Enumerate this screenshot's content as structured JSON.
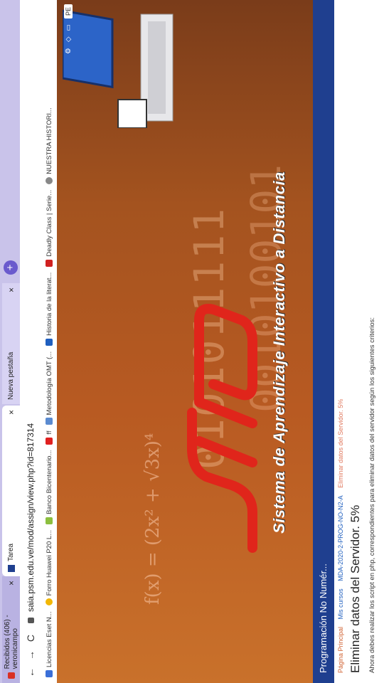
{
  "tabs": [
    {
      "label": "Recibidos (406) - veronicampo",
      "close": "×"
    },
    {
      "label": "Tarea",
      "close": "×"
    },
    {
      "label": "Nueva pestaña",
      "close": "×"
    }
  ],
  "new_tab": "+",
  "toolbar": {
    "back": "←",
    "forward": "→",
    "reload": "C",
    "url": "saia.psm.edu.ve/mod/assign/view.php?id=817314"
  },
  "bookmarks": [
    {
      "label": "Licencias Eset N...",
      "color": "#3a6fd8"
    },
    {
      "label": "Forro Huawei P20 L...",
      "color": "#f2b705"
    },
    {
      "label": "Banco Bicentenario...",
      "color": "#8cbf3f"
    },
    {
      "label": "ff",
      "color": "#e02020"
    },
    {
      "label": "Metodología OMT (...",
      "color": "#5b8bd0"
    },
    {
      "label": "Historia de la literat...",
      "color": "#1f5fbf"
    },
    {
      "label": "Deadly Class | Serie...",
      "color": "#d02020"
    },
    {
      "label": "NUESTRA HISTORI...",
      "color": "#888888"
    }
  ],
  "banner": {
    "formula": "f(x) = (2x² + √3x)⁴",
    "binary_line_1": "0101011111",
    "binary_line_2": "0010100101",
    "tagline": "Sistema de Aprendizaje Interactivo a Distancia",
    "user_short": "PE"
  },
  "coursebar": {
    "title": "Programación No Numér..."
  },
  "breadcrumb": [
    {
      "label": "Página Principal",
      "type": "home"
    },
    {
      "label": "Mis cursos",
      "type": "link"
    },
    {
      "label": "MDA-2020-2-PROG-NO-N2-A",
      "type": "link"
    },
    {
      "label": "Eliminar datos del Servidor. 5%",
      "type": "current"
    }
  ],
  "page": {
    "title": "Eliminar datos del Servidor. 5%",
    "intro": "Ahora debes realizar los script en php, correspondientes para eliminar datos del servidor según los siguientes criterios:"
  },
  "colors": {
    "tabbar": "#c9c3ea",
    "coursebar": "#1f3f8f",
    "banner": "#b85a22",
    "accent_red": "#d02020"
  }
}
